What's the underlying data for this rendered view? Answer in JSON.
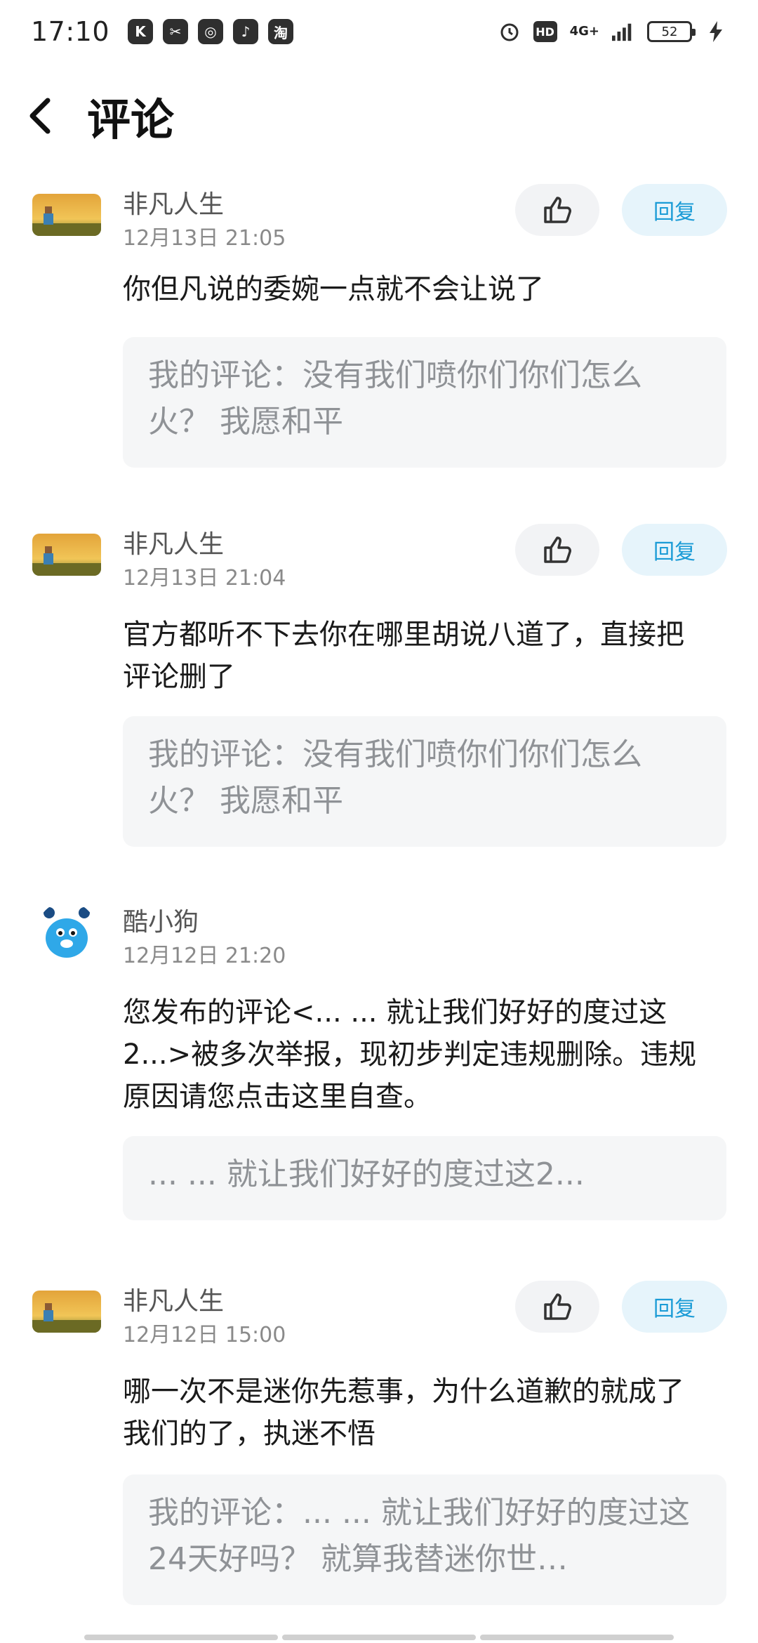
{
  "status_bar": {
    "time": "17:10",
    "apps": [
      "K",
      "✂",
      "◎",
      "♪",
      "淘"
    ],
    "hd": "HD",
    "network": "4G+",
    "battery": "52"
  },
  "header": {
    "title": "评论"
  },
  "comments": [
    {
      "name": "非凡人生",
      "time": "12月13日 21:05",
      "text": "你但凡说的委婉一点就不会让说了",
      "quote": "我的评论：没有我们喷你们你们怎么火？ 我愿和平",
      "reply_label": "回复"
    },
    {
      "name": "非凡人生",
      "time": "12月13日 21:04",
      "text": "官方都听不下去你在哪里胡说八道了，直接把评论删了",
      "quote": "我的评论：没有我们喷你们你们怎么火？ 我愿和平",
      "reply_label": "回复"
    },
    {
      "name": "酷小狗",
      "time": "12月12日 21:20",
      "text": "您发布的评论<... ...  就让我们好好的度过这2...>被多次举报，现初步判定违规删除。违规原因请您点击这里自查。",
      "quote": "... ...  就让我们好好的度过这2..."
    },
    {
      "name": "非凡人生",
      "time": "12月12日 15:00",
      "text": "哪一次不是迷你先惹事，为什么道歉的就成了我们的了，执迷不悟",
      "quote": "我的评论：... ...  就让我们好好的度过这24天好吗？ 就算我替迷你世…",
      "reply_label": "回复"
    }
  ],
  "colors": {
    "reply_text": "#1a9bd6",
    "reply_bg": "#e6f4fb",
    "like_bg": "#f2f3f5",
    "quote_bg": "#f5f6f7"
  }
}
